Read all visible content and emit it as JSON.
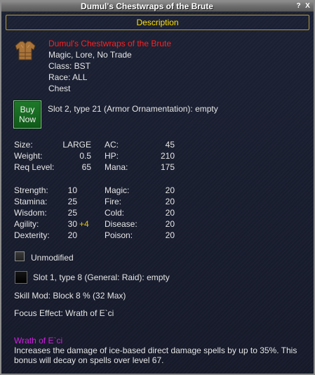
{
  "window": {
    "title": "Dumul's Chestwraps of the Brute",
    "help_label": "?",
    "close_label": "X"
  },
  "section_header": "Description",
  "item": {
    "name": "Dumul's Chestwraps of the Brute",
    "flags": "Magic, Lore, No Trade",
    "class": "Class: BST",
    "race": "Race: ALL",
    "slot": "Chest",
    "icon": "chestwrap-armor-icon"
  },
  "buy_button": {
    "line1": "Buy",
    "line2": "Now"
  },
  "ornament_slot": "Slot 2, type 21 (Armor Ornamentation): empty",
  "stats_basic": [
    {
      "label": "Size:",
      "value": "LARGE",
      "label2": "AC:",
      "value2": "45"
    },
    {
      "label": "Weight:",
      "value": "0.5",
      "label2": "HP:",
      "value2": "210"
    },
    {
      "label": "Req Level:",
      "value": "65",
      "label2": "Mana:",
      "value2": "175"
    }
  ],
  "stats_attr": [
    {
      "label": "Strength:",
      "value": "10",
      "bonus": "",
      "label2": "Magic:",
      "value2": "20"
    },
    {
      "label": "Stamina:",
      "value": "25",
      "bonus": "",
      "label2": "Fire:",
      "value2": "20"
    },
    {
      "label": "Wisdom:",
      "value": "25",
      "bonus": "",
      "label2": "Cold:",
      "value2": "20"
    },
    {
      "label": "Agility:",
      "value": "30",
      "bonus": "+4",
      "label2": "Disease:",
      "value2": "20"
    },
    {
      "label": "Dexterity:",
      "value": "20",
      "bonus": "",
      "label2": "Poison:",
      "value2": "20"
    }
  ],
  "unmodified_label": "Unmodified",
  "aug_slot": "Slot 1, type 8 (General: Raid): empty",
  "skill_mod": "Skill Mod: Block 8 % (32 Max)",
  "focus_effect": "Focus Effect: Wrath of E`ci",
  "focus": {
    "name": "Wrath of E`ci",
    "description": "Increases the damage of ice-based direct damage spells by up to 35%. This bonus will decay on spells over level 67."
  },
  "colors": {
    "item_name": "#ff2020",
    "header": "#ffe000",
    "bonus": "#e2c21a",
    "focus_name": "#d020e0",
    "buy_button": "#1f7a2a"
  }
}
